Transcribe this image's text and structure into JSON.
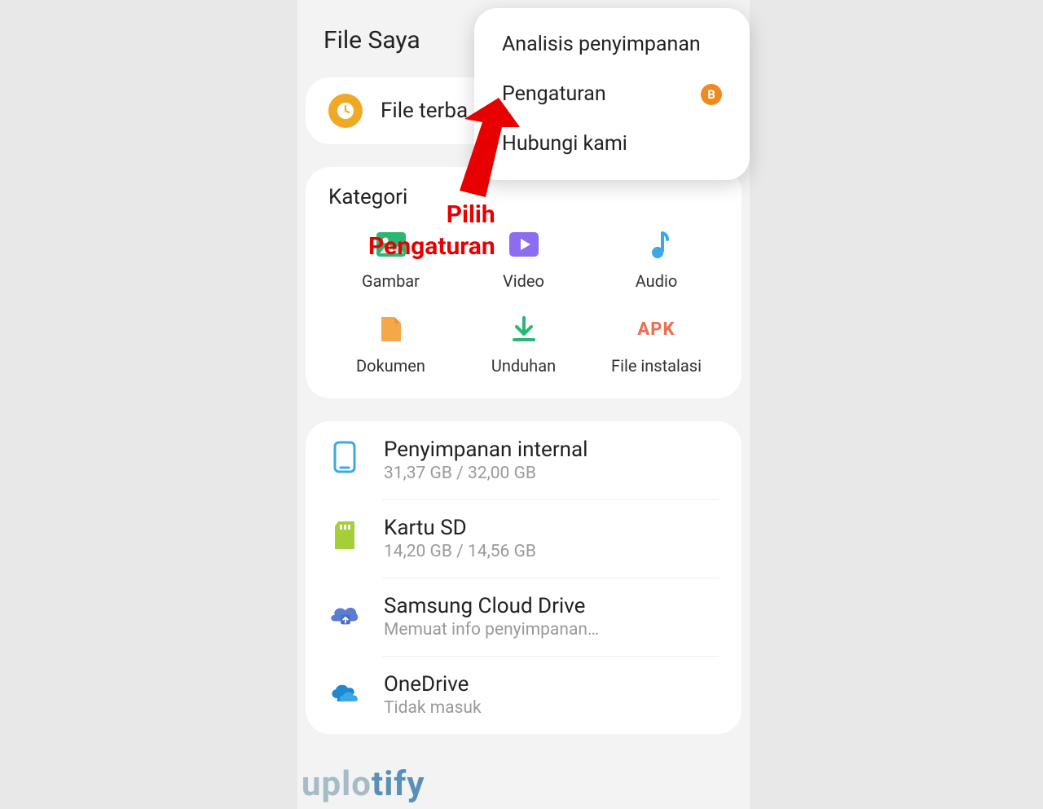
{
  "header": {
    "title": "File Saya"
  },
  "recent": {
    "label": "File terba"
  },
  "popup": {
    "items": [
      {
        "label": "Analisis penyimpanan",
        "badge": ""
      },
      {
        "label": "Pengaturan",
        "badge": "B"
      },
      {
        "label": "Hubungi kami",
        "badge": ""
      }
    ]
  },
  "annotation": {
    "line1": "Pilih",
    "line2": "Pengaturan"
  },
  "categories": {
    "title": "Kategori",
    "items": [
      {
        "label": "Gambar"
      },
      {
        "label": "Video"
      },
      {
        "label": "Audio"
      },
      {
        "label": "Dokumen"
      },
      {
        "label": "Unduhan"
      },
      {
        "label": "File instalasi"
      }
    ],
    "apk_text": "APK"
  },
  "storage": {
    "items": [
      {
        "title": "Penyimpanan internal",
        "sub": "31,37 GB / 32,00 GB"
      },
      {
        "title": "Kartu SD",
        "sub": "14,20 GB / 14,56 GB"
      },
      {
        "title": "Samsung Cloud Drive",
        "sub": "Memuat info penyimpanan…"
      },
      {
        "title": "OneDrive",
        "sub": "Tidak masuk"
      }
    ]
  },
  "watermark": {
    "part1": "uplo",
    "part2": "tify"
  }
}
